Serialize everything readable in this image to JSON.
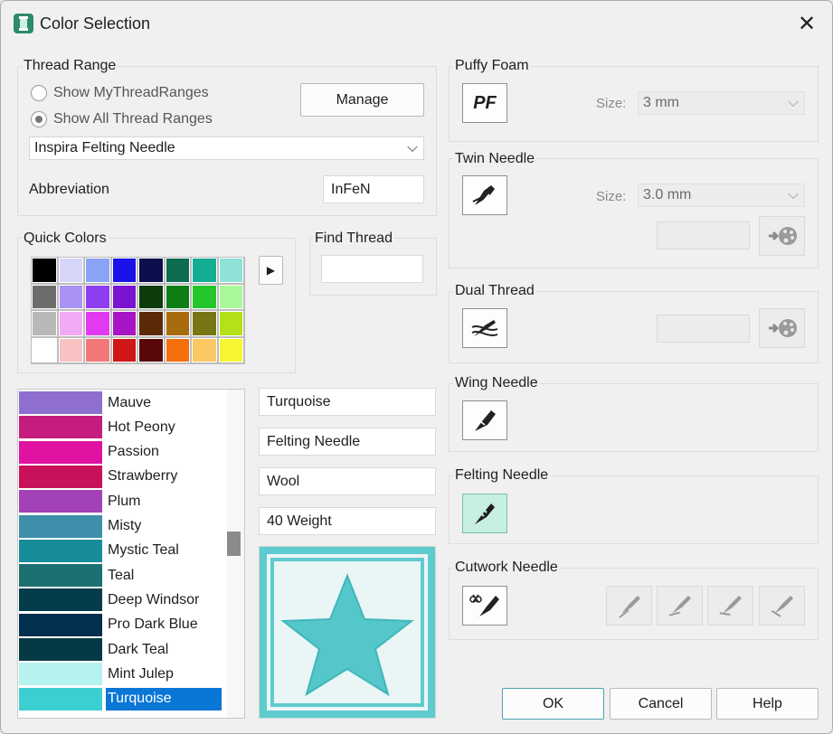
{
  "window": {
    "title": "Color Selection"
  },
  "icons": {
    "app": "thread-spool-icon",
    "close": "close-icon"
  },
  "thread_range": {
    "label": "Thread Range",
    "radio_my": "Show MyThreadRanges",
    "radio_all": "Show All Thread Ranges",
    "selected_radio": "all",
    "manage": "Manage",
    "range_value": "Inspira Felting Needle",
    "abbreviation_label": "Abbreviation",
    "abbreviation_value": "InFeN"
  },
  "quick_colors": {
    "label": "Quick Colors",
    "swatches": [
      "#000000",
      "#d6d6fb",
      "#8aa3f7",
      "#1a12e8",
      "#0c0f4d",
      "#0d6b52",
      "#14ad93",
      "#8ee3d6",
      "#6c6c6c",
      "#a992f3",
      "#8f3df0",
      "#7b14d2",
      "#0c3b0c",
      "#0f7d16",
      "#24c62a",
      "#a8f89a",
      "#b8b8b8",
      "#f2a9f6",
      "#e23af0",
      "#a814c4",
      "#5c2a07",
      "#a86b0c",
      "#787614",
      "#b4e117",
      "#ffffff",
      "#f8c2c3",
      "#f27878",
      "#d01616",
      "#580808",
      "#f56f0c",
      "#fbc863",
      "#f9f532"
    ],
    "more_arrow": "▶"
  },
  "find_thread": {
    "label": "Find Thread",
    "value": ""
  },
  "thread_list": [
    {
      "name": "Mauve",
      "color": "#8e6ecf"
    },
    {
      "name": "Hot Peony",
      "color": "#c51d7f"
    },
    {
      "name": "Passion",
      "color": "#e012a1"
    },
    {
      "name": "Strawberry",
      "color": "#c8115b"
    },
    {
      "name": "Plum",
      "color": "#a341b7"
    },
    {
      "name": "Misty",
      "color": "#3f8eaa"
    },
    {
      "name": "Mystic Teal",
      "color": "#168d99"
    },
    {
      "name": "Teal",
      "color": "#1c706f"
    },
    {
      "name": "Deep Windsor",
      "color": "#053c4a"
    },
    {
      "name": "Pro Dark Blue",
      "color": "#04304f"
    },
    {
      "name": "Dark Teal",
      "color": "#053a45"
    },
    {
      "name": "Mint Julep",
      "color": "#b6f2ef"
    },
    {
      "name": "Turquoise",
      "color": "#3ccfd2",
      "selected": true
    }
  ],
  "details": {
    "color_name": "Turquoise",
    "range": "Felting Needle",
    "material": "Wool",
    "weight": "40 Weight"
  },
  "preview": {
    "color": "#53c6ca",
    "icon": "star-thread-preview"
  },
  "puffy_foam": {
    "label": "Puffy Foam",
    "button_text": "PF",
    "size_label": "Size:",
    "size_value": "3 mm"
  },
  "twin_needle": {
    "label": "Twin Needle",
    "size_label": "Size:",
    "size_value": "3.0 mm",
    "icon": "twin-needle-icon",
    "palette_icon": "apply-palette-icon"
  },
  "dual_thread": {
    "label": "Dual Thread",
    "icon": "dual-thread-icon",
    "palette_icon": "apply-palette-icon"
  },
  "wing_needle": {
    "label": "Wing Needle",
    "icon": "wing-needle-icon"
  },
  "felting_needle": {
    "label": "Felting Needle",
    "icon": "felting-needle-icon"
  },
  "cutwork_needle": {
    "label": "Cutwork Needle",
    "icon": "cutwork-needle-icon",
    "angle_icons": [
      "cutwork-angle-1-icon",
      "cutwork-angle-2-icon",
      "cutwork-angle-3-icon",
      "cutwork-angle-4-icon"
    ]
  },
  "footer": {
    "ok": "OK",
    "cancel": "Cancel",
    "help": "Help"
  }
}
